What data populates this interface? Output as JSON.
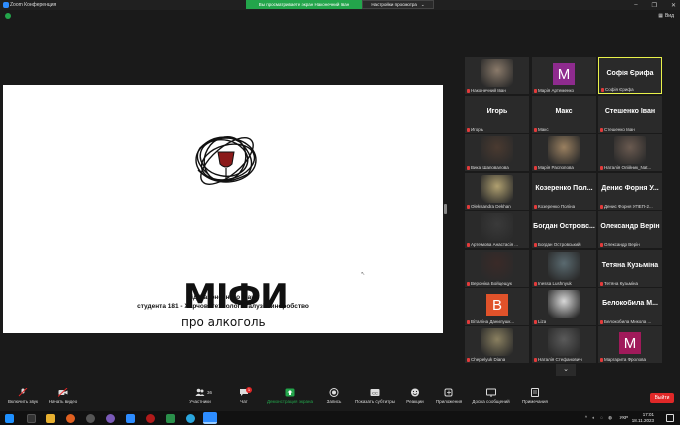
{
  "window": {
    "title": "Zoom Конференция",
    "share_banner": "Вы просматриваете экран Наконечний Іван",
    "view_settings": "Настройки просмотра",
    "view_button": "Вид"
  },
  "slide": {
    "title": "МІФИ",
    "subtitle": "про алкоголь",
    "author_line1": "від Наконечного Івана",
    "author_line2": "студента 181 - Харчові технології галузі виноробство"
  },
  "participants": [
    {
      "display": "",
      "name": "Наконечний Іван",
      "kind": "photo",
      "color": "#8a7a6a"
    },
    {
      "display": "M",
      "name": "Марія Артеменко",
      "kind": "letter",
      "color": "#8e2b8e"
    },
    {
      "display": "Софія Єрифа",
      "name": "Софія Єрифа",
      "kind": "text",
      "active": true
    },
    {
      "display": "Игорь",
      "name": "Игорь",
      "kind": "text"
    },
    {
      "display": "Макс",
      "name": "Макс",
      "kind": "text"
    },
    {
      "display": "Стешенко Іван",
      "name": "Стешенко Іван",
      "kind": "text"
    },
    {
      "display": "",
      "name": "Вика Шаповалова",
      "kind": "photo",
      "color": "#4a3a30"
    },
    {
      "display": "",
      "name": "Марія Распопова",
      "kind": "photo",
      "color": "#9a8060"
    },
    {
      "display": "",
      "name": "Наталія Олійник_Nat...",
      "kind": "photo",
      "color": "#6a5a50"
    },
    {
      "display": "",
      "name": "Oleksandra Dekhan",
      "kind": "photo",
      "color": "#b0a070"
    },
    {
      "display": "Козеренко Пол...",
      "name": "Козеренко Поліна",
      "kind": "text"
    },
    {
      "display": "Денис Форня У...",
      "name": "Денис Форня УПЕП-2...",
      "kind": "text"
    },
    {
      "display": "",
      "name": "Артемова Анастасія ...",
      "kind": "photo",
      "color": "#3a3a3a"
    },
    {
      "display": "Богдан Островс...",
      "name": "Богдан Островський",
      "kind": "text"
    },
    {
      "display": "Олександр Верін",
      "name": "Олександр Верін",
      "kind": "text"
    },
    {
      "display": "",
      "name": "Вероніка Бойцещук",
      "kind": "photo",
      "color": "#3a2a28"
    },
    {
      "display": "",
      "name": "Inessa Lushnyuk",
      "kind": "photo",
      "color": "#5a6a70"
    },
    {
      "display": "Тетяна Кузьміна",
      "name": "Тетяна Кузьміна",
      "kind": "text"
    },
    {
      "display": "B",
      "name": "Віталіна Данилушк...",
      "kind": "letter",
      "color": "#e0522a"
    },
    {
      "display": "",
      "name": "Liza",
      "kind": "photo",
      "color": "#d8d8d8"
    },
    {
      "display": "Белокобила М...",
      "name": "Белокобила Микола ...",
      "kind": "text"
    },
    {
      "display": "",
      "name": "Chepelyuk Diana",
      "kind": "photo",
      "color": "#8a8060"
    },
    {
      "display": "",
      "name": "Наталія Стефанович",
      "kind": "photo",
      "color": "#5a5a5a"
    },
    {
      "display": "M",
      "name": "Маргарита Фролова",
      "kind": "letter",
      "color": "#a01a5a"
    }
  ],
  "toolbar": {
    "audio": "Включить звук",
    "video": "Начать видео",
    "participants": "Участники",
    "participants_count": "36",
    "chat": "Чат",
    "chat_badge": "1",
    "share": "Демонстрация экрана",
    "record": "Запись",
    "captions": "Показать субтитры",
    "reactions": "Реакции",
    "apps": "Приложения",
    "whiteboard": "Доска сообщений",
    "notes": "Примечания",
    "leave": "Выйти"
  },
  "taskbar": {
    "time": "17:01",
    "date": "18.11.2023",
    "lang": "УКР"
  },
  "colors": {
    "share_green": "#23a54b",
    "active_border": "#e9f24a",
    "leave_red": "#e02828"
  }
}
